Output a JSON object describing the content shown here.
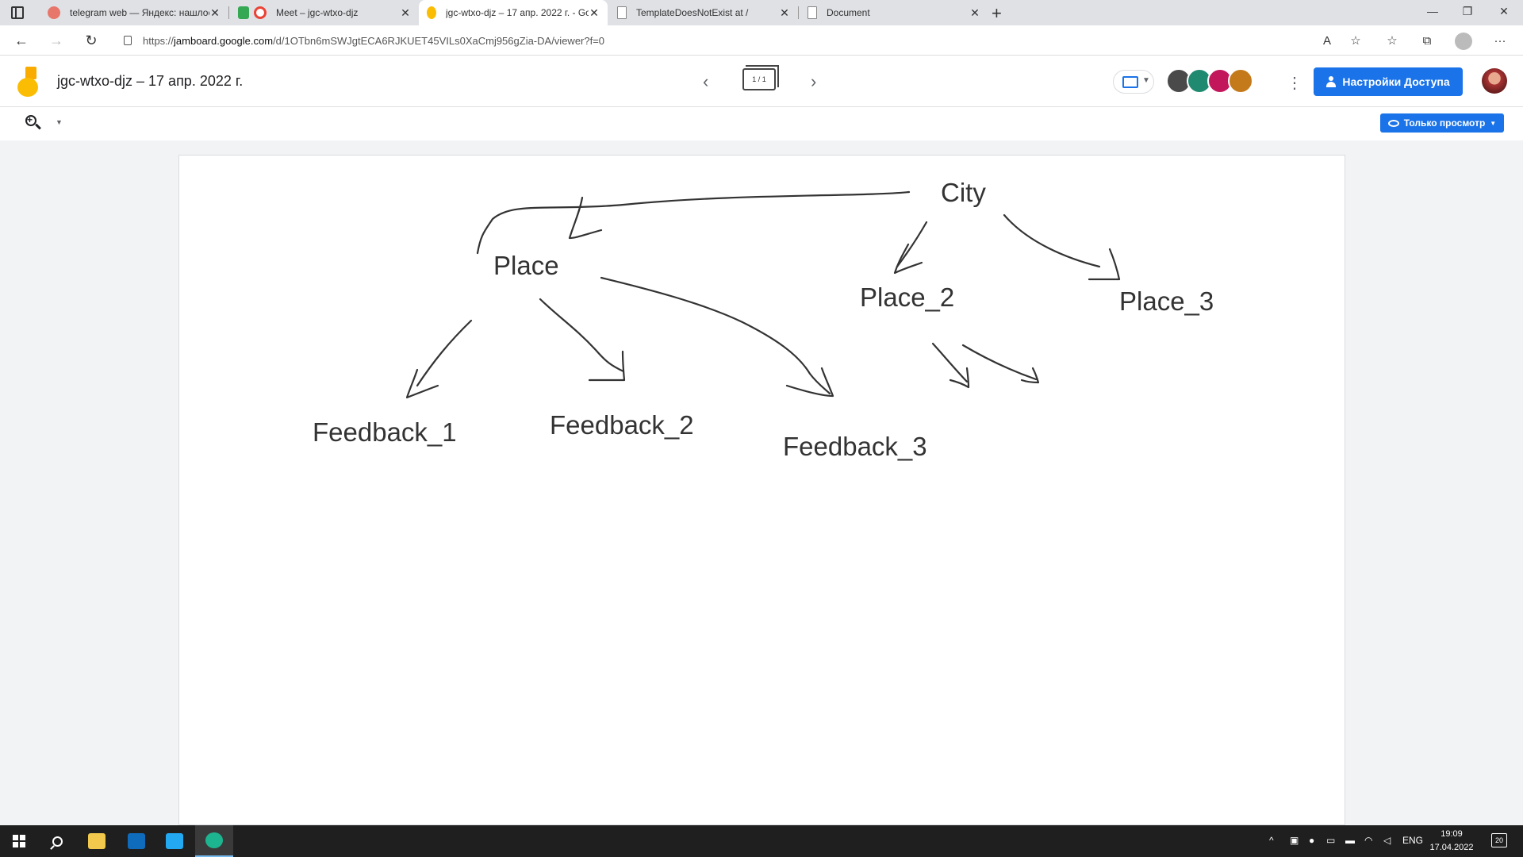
{
  "browser": {
    "tabs": [
      {
        "title": "telegram web — Яндекс: нашлось",
        "favicon_color": "#e8776b",
        "active": false
      },
      {
        "title": "Meet – jgc-wtxo-djz",
        "favicon_color": "#ea4335",
        "active": false
      },
      {
        "title": "jgc-wtxo-djz – 17 апр. 2022 г. - Google Jamboard",
        "favicon_color": "#fbbc04",
        "active": true
      },
      {
        "title": "TemplateDoesNotExist at /",
        "favicon_color": "#888888",
        "active": false
      },
      {
        "title": "Document",
        "favicon_color": "#888888",
        "active": false
      }
    ],
    "url_prefix": "https://",
    "url_host": "jamboard.google.com",
    "url_path": "/d/1OTbn6mSWJgtECA6RJKUET45VILs0XaCmj956gZia-DA/viewer?f=0"
  },
  "jamboard": {
    "title": "jgc-wtxo-djz – 17 апр. 2022 г.",
    "frame_counter": "1 / 1",
    "share_label": "Настройки Доступа",
    "view_mode_label": "Только просмотр",
    "collaborator_colors": [
      "#4a4a4a",
      "#1f8a70",
      "#c2185b",
      "#c47a1b"
    ],
    "accent_color": "#1a73e8"
  },
  "board": {
    "nodes": [
      {
        "id": "city",
        "label": "City"
      },
      {
        "id": "place",
        "label": "Place"
      },
      {
        "id": "place2",
        "label": "Place_2"
      },
      {
        "id": "place3",
        "label": "Place_3"
      },
      {
        "id": "fb1",
        "label": "Feedback_1"
      },
      {
        "id": "fb2",
        "label": "Feedback_2"
      },
      {
        "id": "fb3",
        "label": "Feedback_3"
      }
    ]
  },
  "taskbar": {
    "language": "ENG",
    "time": "19:09",
    "date": "17.04.2022",
    "notifications": "20"
  }
}
